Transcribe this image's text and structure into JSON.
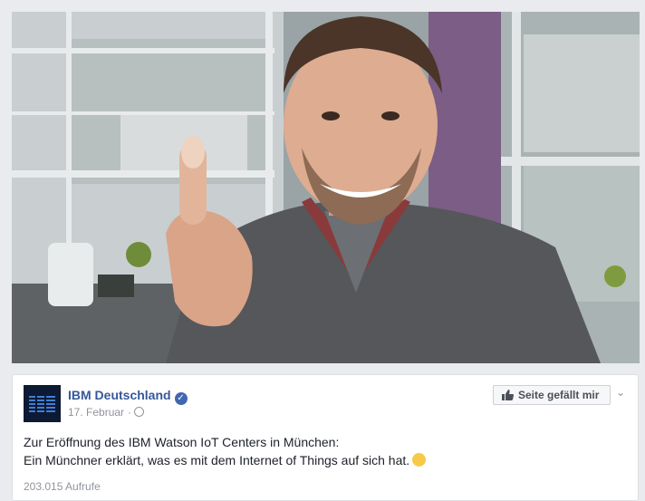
{
  "video": {
    "description_icon": "video-thumbnail"
  },
  "post": {
    "page_name": "IBM Deutschland",
    "date": "17. Februar",
    "separator": "·",
    "like_button_label": "Seite gefällt mir",
    "text_line_1": "Zur Eröffnung des IBM Watson IoT Centers in München:",
    "text_line_2": "Ein Münchner erklärt, was es mit dem Internet of Things auf sich hat.",
    "views": "203.015 Aufrufe"
  },
  "colors": {
    "link": "#365899",
    "verified": "#4267b2",
    "muted": "#90949c"
  }
}
